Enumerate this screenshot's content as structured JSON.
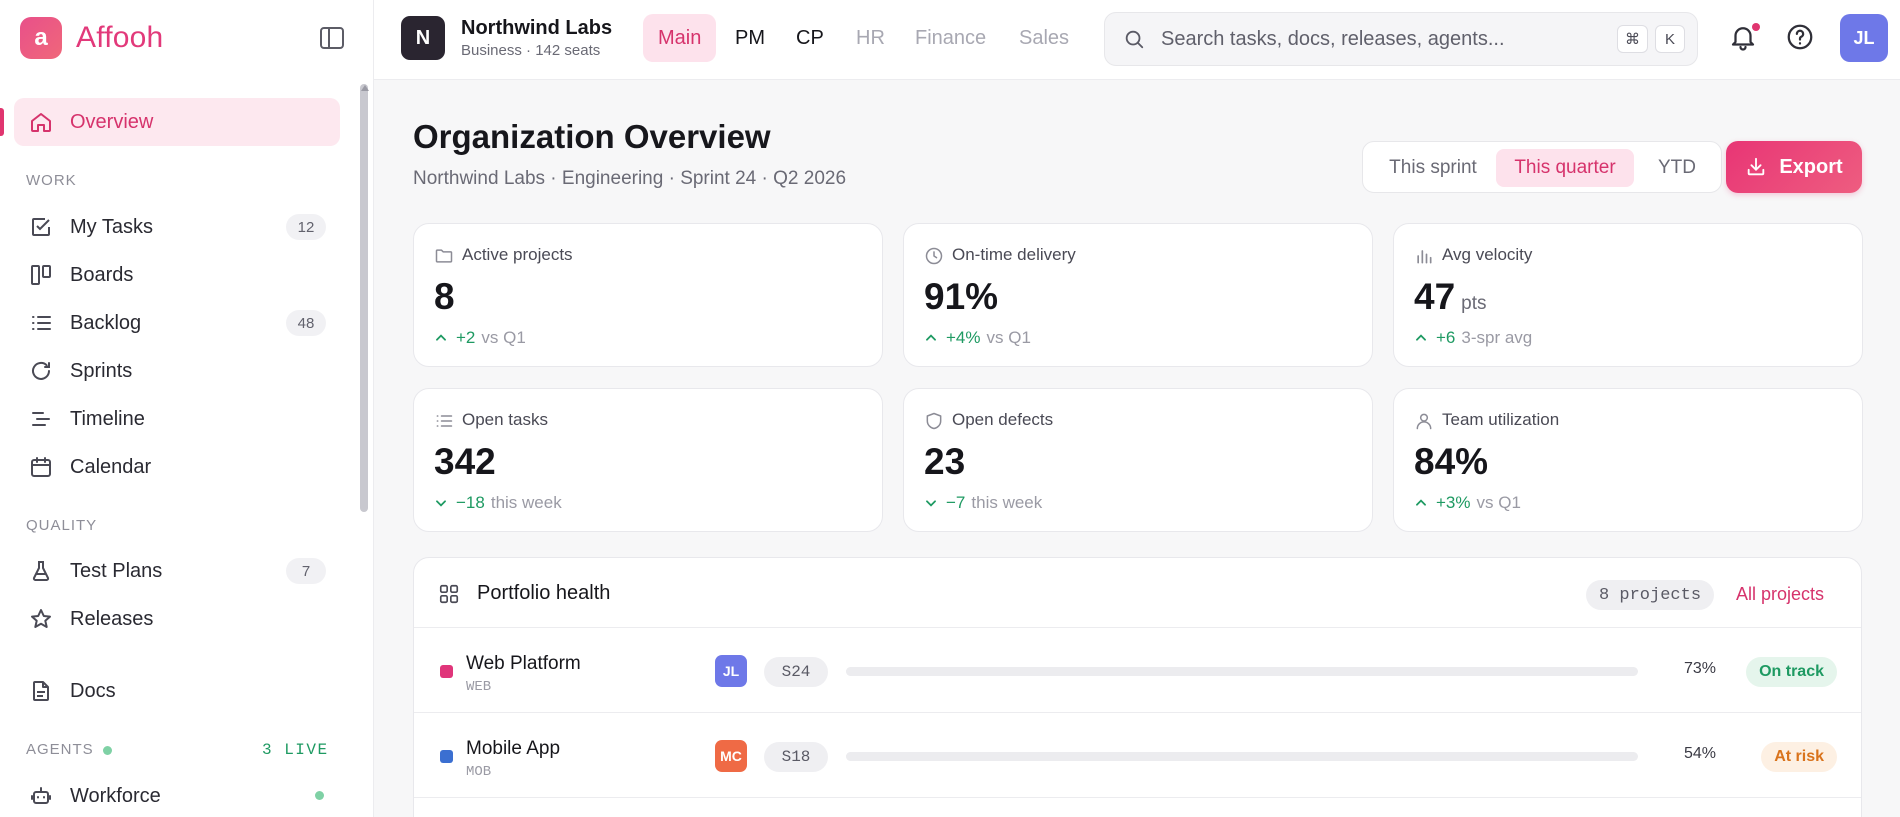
{
  "brand": {
    "logo_letter": "a",
    "name": "Affooh",
    "accent": "#e2397a"
  },
  "sidebar": {
    "primary": [
      {
        "label": "Overview",
        "icon": "home-icon",
        "active": true
      }
    ],
    "work_label": "WORK",
    "work": [
      {
        "label": "My Tasks",
        "icon": "checkbox-icon",
        "badge": "12"
      },
      {
        "label": "Boards",
        "icon": "board-icon",
        "badge": ""
      },
      {
        "label": "Backlog",
        "icon": "list-icon",
        "badge": "48"
      },
      {
        "label": "Sprints",
        "icon": "sprint-icon",
        "badge": ""
      },
      {
        "label": "Timeline",
        "icon": "timeline-icon",
        "badge": ""
      },
      {
        "label": "Calendar",
        "icon": "calendar-icon",
        "badge": ""
      }
    ],
    "quality_label": "QUALITY",
    "quality": [
      {
        "label": "Test Plans",
        "icon": "flask-icon",
        "badge": "7"
      },
      {
        "label": "Releases",
        "icon": "star-icon",
        "badge": ""
      }
    ],
    "docs": {
      "label": "Docs",
      "icon": "document-icon"
    },
    "agents_label": "AGENTS",
    "agents_live": "3 LIVE",
    "agents": [
      {
        "label": "Workforce",
        "icon": "robot-icon"
      }
    ]
  },
  "topbar": {
    "org": {
      "initial": "N",
      "name": "Northwind Labs",
      "plan": "Business · 142 seats"
    },
    "modes": [
      {
        "label": "Main",
        "state": "active"
      },
      {
        "label": "PM",
        "state": "dark"
      },
      {
        "label": "CP",
        "state": "dark"
      },
      {
        "label": "HR",
        "state": "dim"
      },
      {
        "label": "Finance",
        "state": "dim"
      },
      {
        "label": "Sales",
        "state": "dim"
      }
    ],
    "search": {
      "placeholder": "Search tasks, docs, releases, agents...",
      "shortcut_cmd": "⌘",
      "shortcut_key": "K"
    },
    "user_initials": "JL"
  },
  "main": {
    "title": "Organization Overview",
    "subtitle": "Northwind Labs · Engineering · Sprint 24 · Q2 2026",
    "ranges": [
      {
        "label": "This sprint",
        "active": false
      },
      {
        "label": "This quarter",
        "active": true
      },
      {
        "label": "YTD",
        "active": false
      }
    ],
    "export_label": "Export",
    "kpis": [
      {
        "label": "Active projects",
        "icon": "folder-icon",
        "value": "8",
        "unit": "",
        "delta": "+2",
        "delta_note": "vs Q1",
        "trend": "up"
      },
      {
        "label": "On-time delivery",
        "icon": "clock-icon",
        "value": "91%",
        "unit": "",
        "delta": "+4%",
        "delta_note": "vs Q1",
        "trend": "up"
      },
      {
        "label": "Avg velocity",
        "icon": "bar-chart-icon",
        "value": "47",
        "unit": "pts",
        "delta": "+6",
        "delta_note": "3-spr avg",
        "trend": "up"
      },
      {
        "label": "Open tasks",
        "icon": "list-icon",
        "value": "342",
        "unit": "",
        "delta": "−18",
        "delta_note": "this week",
        "trend": "down"
      },
      {
        "label": "Open defects",
        "icon": "shield-icon",
        "value": "23",
        "unit": "",
        "delta": "−7",
        "delta_note": "this week",
        "trend": "down"
      },
      {
        "label": "Team utilization",
        "icon": "user-icon",
        "value": "84%",
        "unit": "",
        "delta": "+3%",
        "delta_note": "vs Q1",
        "trend": "up"
      }
    ],
    "portfolio": {
      "title": "Portfolio health",
      "count": "8 projects",
      "all_link": "All projects",
      "rows": [
        {
          "name": "Web Platform",
          "code": "WEB",
          "color": "#e0357a",
          "owner": "JL",
          "owner_color": "#6e78e8",
          "sprint": "S24",
          "progress": 0.73,
          "pct": "73%",
          "status": "On track",
          "status_fg": "#1e9a62",
          "status_bg": "#e5f5ec"
        },
        {
          "name": "Mobile App",
          "code": "MOB",
          "color": "#3b6fd1",
          "owner": "MC",
          "owner_color": "#ef6a45",
          "sprint": "S18",
          "progress": 0.54,
          "pct": "54%",
          "status": "At risk",
          "status_fg": "#d9731c",
          "status_bg": "#fdf0e3"
        }
      ]
    }
  }
}
